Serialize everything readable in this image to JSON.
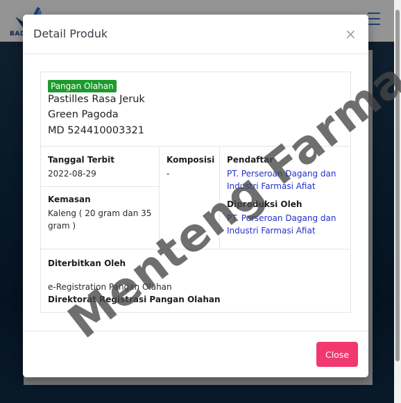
{
  "modal": {
    "title": "Detail Produk",
    "close_icon": "×",
    "close_button": "Close"
  },
  "product": {
    "badge": "Pangan Olahan",
    "name": "Pastilles Rasa Jeruk",
    "brand": "Green Pagoda",
    "registration": "MD 524410003321"
  },
  "details": {
    "tanggal_terbit": {
      "label": "Tanggal Terbit",
      "value": "2022-08-29"
    },
    "kemasan": {
      "label": "Kemasan",
      "value": "Kaleng ( 20 gram dan 35 gram )"
    },
    "komposisi": {
      "label": "Komposisi",
      "value": "-"
    },
    "pendaftar": {
      "label": "Pendaftar",
      "value": "PT. Perseroan Dagang dan Industri Farmasi Afiat"
    },
    "diproduksi_oleh": {
      "label": "Diproduksi Oleh",
      "value": "PT. Perseroan Dagang dan Industri Farmasi Afiat"
    },
    "diterbitkan_oleh": {
      "label": "Diterbitkan Oleh",
      "line1": "e-Registration Pangan Olahan",
      "line2": "Direktorat Registrasi Pangan Olahan"
    }
  },
  "background": {
    "logo_text": "BAD"
  },
  "watermark": "Menteng Farma",
  "colors": {
    "badge": "#1e9a2d",
    "link": "#2230c9",
    "close_button": "#f1386f"
  },
  "icons": {
    "close": "close-icon",
    "menu": "hamburger-menu-icon",
    "logo": "logo-icon"
  }
}
